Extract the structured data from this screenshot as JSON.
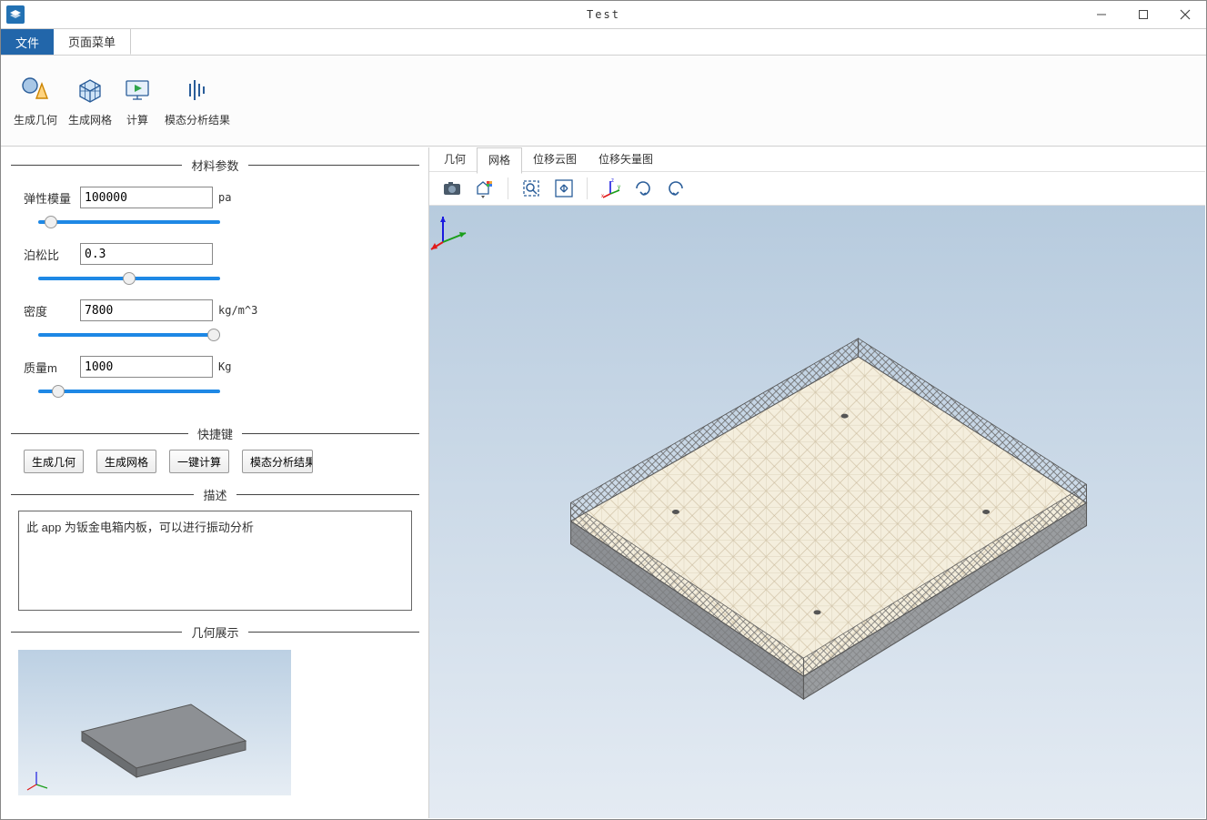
{
  "window": {
    "title": "Test"
  },
  "menu": {
    "tabs": [
      {
        "label": "文件",
        "active": true
      },
      {
        "label": "页面菜单",
        "active": false
      }
    ]
  },
  "ribbon": {
    "items": [
      {
        "label": "生成几何",
        "icon": "sphere-cone"
      },
      {
        "label": "生成网格",
        "icon": "mesh-cube"
      },
      {
        "label": "计算",
        "icon": "play-screen"
      },
      {
        "label": "模态分析结果",
        "icon": "wave"
      }
    ]
  },
  "sections": {
    "material": {
      "title": "材料参数",
      "params": {
        "elastic": {
          "label": "弹性模量",
          "value": "100000",
          "unit": "pa"
        },
        "poisson": {
          "label": "泊松比",
          "value": "0.3",
          "unit": ""
        },
        "density": {
          "label": "密度",
          "value": "7800",
          "unit": "kg/m^3"
        },
        "mass": {
          "label": "质量m",
          "value": "1000",
          "unit": "Kg"
        }
      }
    },
    "shortcuts": {
      "title": "快捷键",
      "buttons": [
        {
          "label": "生成几何"
        },
        {
          "label": "生成网格"
        },
        {
          "label": "一键计算"
        },
        {
          "label": "模态分析结果"
        }
      ]
    },
    "description": {
      "title": "描述",
      "text": "此 app 为钣金电箱内板，可以进行振动分析"
    },
    "geometry_preview": {
      "title": "几何展示"
    }
  },
  "viewport": {
    "tabs": [
      {
        "label": "几何"
      },
      {
        "label": "网格",
        "active": true
      },
      {
        "label": "位移云图"
      },
      {
        "label": "位移矢量图"
      }
    ],
    "toolbar_icons": [
      "camera",
      "palette",
      "zoom-box",
      "zoom-extents",
      "axes",
      "rotate-cw",
      "rotate-ccw"
    ]
  }
}
